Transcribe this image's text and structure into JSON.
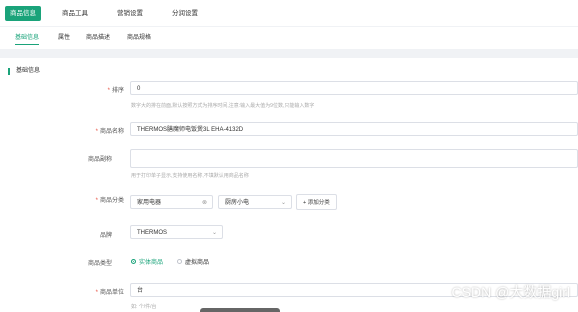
{
  "top_tabs": [
    {
      "label": "商品信息"
    },
    {
      "label": "商品工具"
    },
    {
      "label": "营销设置"
    },
    {
      "label": "分润设置"
    }
  ],
  "sub_tabs": [
    {
      "label": "基础信息"
    },
    {
      "label": "属性"
    },
    {
      "label": "商品描述"
    },
    {
      "label": "商品规格"
    }
  ],
  "section_title": "基础信息",
  "form": {
    "sort": {
      "label": "排序",
      "value": "0",
      "hint": "数字大的排在前面,默认按照方式为排序时间,注意:输入最大值为9位数,只能输入数字"
    },
    "name": {
      "label": "商品名称",
      "value": "THERMOS膳魔师电饭煲3L EHA-4132D"
    },
    "alias": {
      "label": "商品副称",
      "value": "",
      "hint": "用于打印单子显示,支持使用名称,不填默认用商品名称"
    },
    "category": {
      "label": "商品分类",
      "value1": "家用电器",
      "value2": "厨房小电",
      "add_label": "+ 添加分类"
    },
    "brand": {
      "label": "品牌",
      "value": "THERMOS"
    },
    "type": {
      "label": "商品类型",
      "option1": "实体商品",
      "option2": "虚拟商品"
    },
    "unit": {
      "label": "商品单位",
      "value": "台",
      "hint": "如: 个/件/台"
    }
  },
  "watermark": "CSDN @大数据girl"
}
